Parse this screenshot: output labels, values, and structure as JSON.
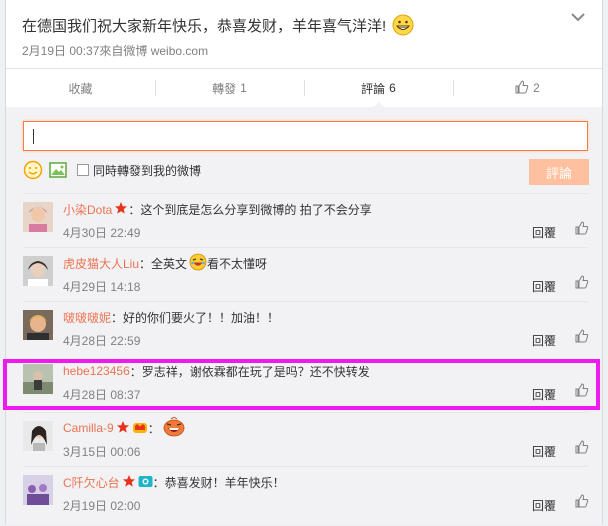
{
  "post": {
    "text": "在德国我们祝大家新年快乐，恭喜发财，羊年喜气洋洋!",
    "emoji_icon": "grinning-face-icon",
    "meta": "2月19日 00:37來自微博 weibo.com",
    "chevron_icon": "chevron-down-icon"
  },
  "actions": {
    "favorite": "收藏",
    "repost_label": "轉發",
    "repost_count": "1",
    "comment_label": "評論",
    "comment_count": "6",
    "like_icon": "thumbs-up-icon",
    "like_count": "2"
  },
  "composer": {
    "value": "",
    "placeholder": "",
    "emoji_icon": "smiley-icon",
    "image_icon": "image-icon",
    "repost_checkbox_label": "同時轉發到我的微博",
    "submit_label": "評論"
  },
  "comments": [
    {
      "user": "小染Dota",
      "badge": "star-icon",
      "text": "：这个到底是怎么分享到微博的 拍了不会分享",
      "time": "4月30日 22:49",
      "reply": "回覆"
    },
    {
      "user": "虎皮猫大人Liu",
      "text_pre": "：全英文",
      "emoji": "crying-laughing-icon",
      "text_post": "看不太懂呀",
      "time": "4月29日 14:18",
      "reply": "回覆"
    },
    {
      "user": "啵啵啵妮",
      "text": "：好的你们要火了！！加油！！",
      "time": "4月28日 22:59",
      "reply": "回覆"
    },
    {
      "user": "hebe123456",
      "text": "：罗志祥，谢依霖都在玩了是吗？还不快转发",
      "time": "4月28日 08:37",
      "reply": "回覆"
    },
    {
      "user": "Camilla-9",
      "badges": [
        "star-icon",
        "crown-icon"
      ],
      "text": "：",
      "emoji": "laughing-face-icon",
      "time": "3月15日 00:06",
      "reply": "回覆"
    },
    {
      "user": "C阡欠心台",
      "badges": [
        "star-icon",
        "camera-icon"
      ],
      "text": "：恭喜发财！羊年快乐！",
      "time": "2月19日 02:00",
      "reply": "回覆"
    }
  ],
  "colors": {
    "accent": "#fa7d3c",
    "username": "#eb7350",
    "highlight": "#ee1bee",
    "submit_disabled": "#ffc09f",
    "panel_bg": "#f2f2f5"
  }
}
